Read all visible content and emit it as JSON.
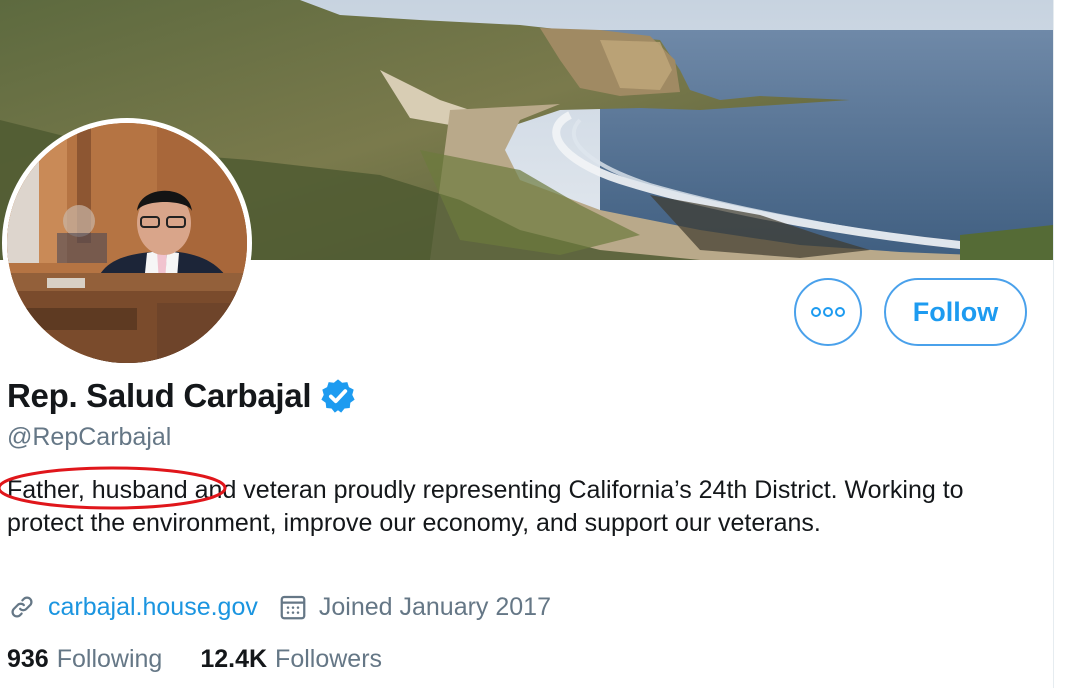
{
  "profile": {
    "name": "Rep. Salud Carbajal",
    "handle": "@RepCarbajal",
    "bio": {
      "circled": "Father, husband",
      "rest": " and veteran proudly representing California’s 24th District. Working to protect the environment, improve our economy, and support our veterans."
    },
    "website": "carbajal.house.gov",
    "joined": "Joined January 2017",
    "following_count": "936",
    "following_label": "Following",
    "followers_count": "12.4K",
    "followers_label": "Followers"
  },
  "actions": {
    "follow_label": "Follow",
    "more_icon": "more-icon"
  },
  "colors": {
    "accent": "#1d9bf0",
    "secondary_text": "#657786",
    "annotation": "#e0161b"
  }
}
